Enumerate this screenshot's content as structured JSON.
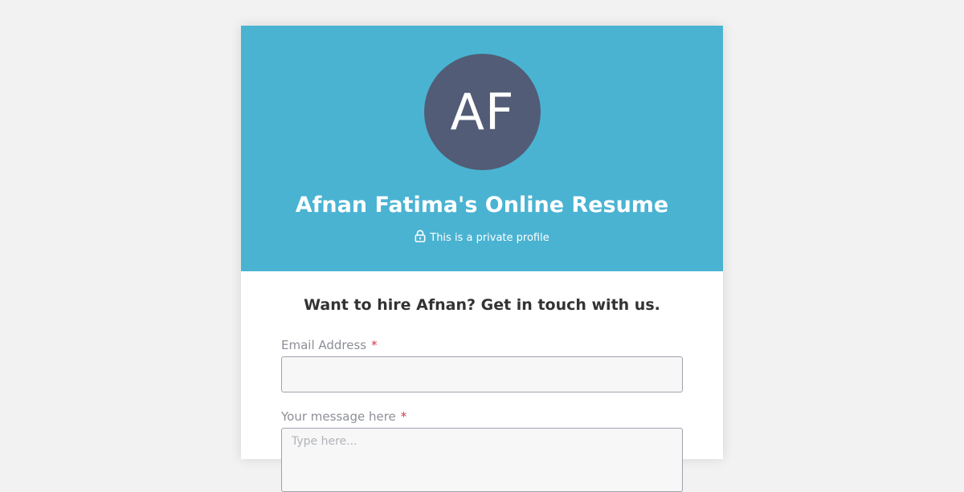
{
  "profile": {
    "initials": "AF",
    "title": "Afnan Fatima's Online Resume",
    "privacy_text": "This is a private profile",
    "privacy_icon": "lock-icon"
  },
  "contact": {
    "headline": "Want to hire Afnan? Get in touch with us.",
    "email_label": "Email Address",
    "email_value": "",
    "required_mark": "*",
    "message_label": "Your message here",
    "message_placeholder": "Type here..."
  },
  "colors": {
    "hero_bg": "#4ab3d2",
    "avatar_bg": "#525c76",
    "required": "#d0394a"
  }
}
